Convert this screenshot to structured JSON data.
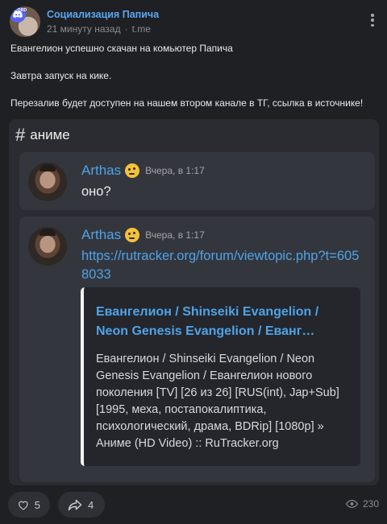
{
  "channel": {
    "name": "Социализация Папича",
    "time_ago": "21 минуту назад",
    "separator": "·",
    "source": "t.me",
    "avatar_label": "ACORD"
  },
  "post": {
    "lines": [
      "Евангелион успешно скачан на комьютер Папича",
      "Завтра запуск на кике.",
      "Перезалив будет доступен на нашем втором канале в ТГ, ссылка в источнике!"
    ]
  },
  "discord": {
    "channel_hash": "#",
    "channel_name": "аниме",
    "messages": [
      {
        "author": "Arthas",
        "time": "Вчера, в 1:17",
        "text": "оно?"
      },
      {
        "author": "Arthas",
        "time": "Вчера, в 1:17",
        "link": "https://rutracker.org/forum/viewtopic.php?t=6058033",
        "embed": {
          "title_line1": "Евангелион / Shinseiki Evangelion /",
          "title_line2": "Neon Genesis Evangelion / Еванг…",
          "description": "Евангелион / Shinseiki Evangelion / Neon Genesis Evangelion / Евангелион нового поколения [TV] [26 из 26] [RUS(int), Jap+Sub] [1995, меха, постапокалиптика, психологический, драма, BDRip] [1080p] » Аниме (HD Video) :: RuTracker.org"
        }
      }
    ]
  },
  "footer": {
    "likes": "5",
    "shares": "4",
    "views": "230"
  },
  "icons": {
    "like": "heart-icon",
    "share": "share-arrow-icon",
    "views": "eye-icon",
    "more": "more-vertical-icon",
    "emoji": "thinking-face-emoji-icon"
  },
  "colors": {
    "background": "#1f2024",
    "accent": "#5aa7f2",
    "discord_panel": "#2a2c31",
    "message_bg": "#34363d",
    "link": "#4fa3e8"
  }
}
